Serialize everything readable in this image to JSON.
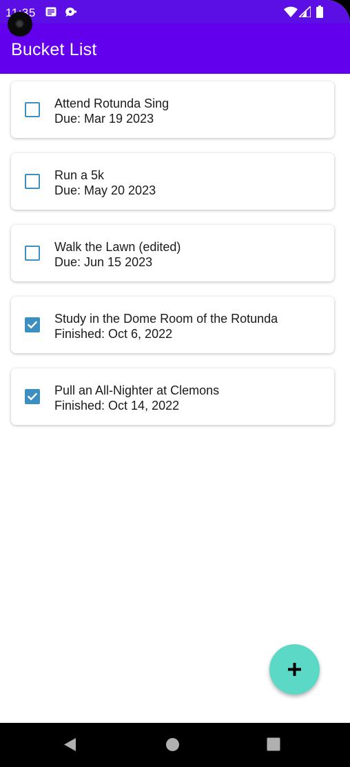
{
  "status_bar": {
    "time": "11:35",
    "icons": [
      "message-icon",
      "chat-bubble-icon",
      "wifi-icon",
      "signal-icon",
      "battery-icon"
    ]
  },
  "app_bar": {
    "title": "Bucket List"
  },
  "items": [
    {
      "title": "Attend Rotunda Sing",
      "date_text": "Due: Mar 19 2023",
      "checked": false
    },
    {
      "title": "Run a 5k",
      "date_text": "Due: May 20 2023",
      "checked": false
    },
    {
      "title": "Walk the Lawn (edited)",
      "date_text": "Due: Jun 15 2023",
      "checked": false
    },
    {
      "title": "Study in the Dome Room of the Rotunda",
      "date_text": "Finished: Oct 6, 2022",
      "checked": true
    },
    {
      "title": "Pull an All-Nighter at Clemons",
      "date_text": "Finished: Oct 14, 2022",
      "checked": true
    }
  ],
  "fab": {
    "icon": "plus-icon"
  },
  "nav_bar": {
    "icons": [
      "back-icon",
      "home-icon",
      "recents-icon"
    ]
  },
  "colors": {
    "status_bar": "#5b0fe4",
    "app_bar": "#6200ee",
    "checkbox": "#3d8fbf",
    "fab": "#5cd8c6"
  }
}
